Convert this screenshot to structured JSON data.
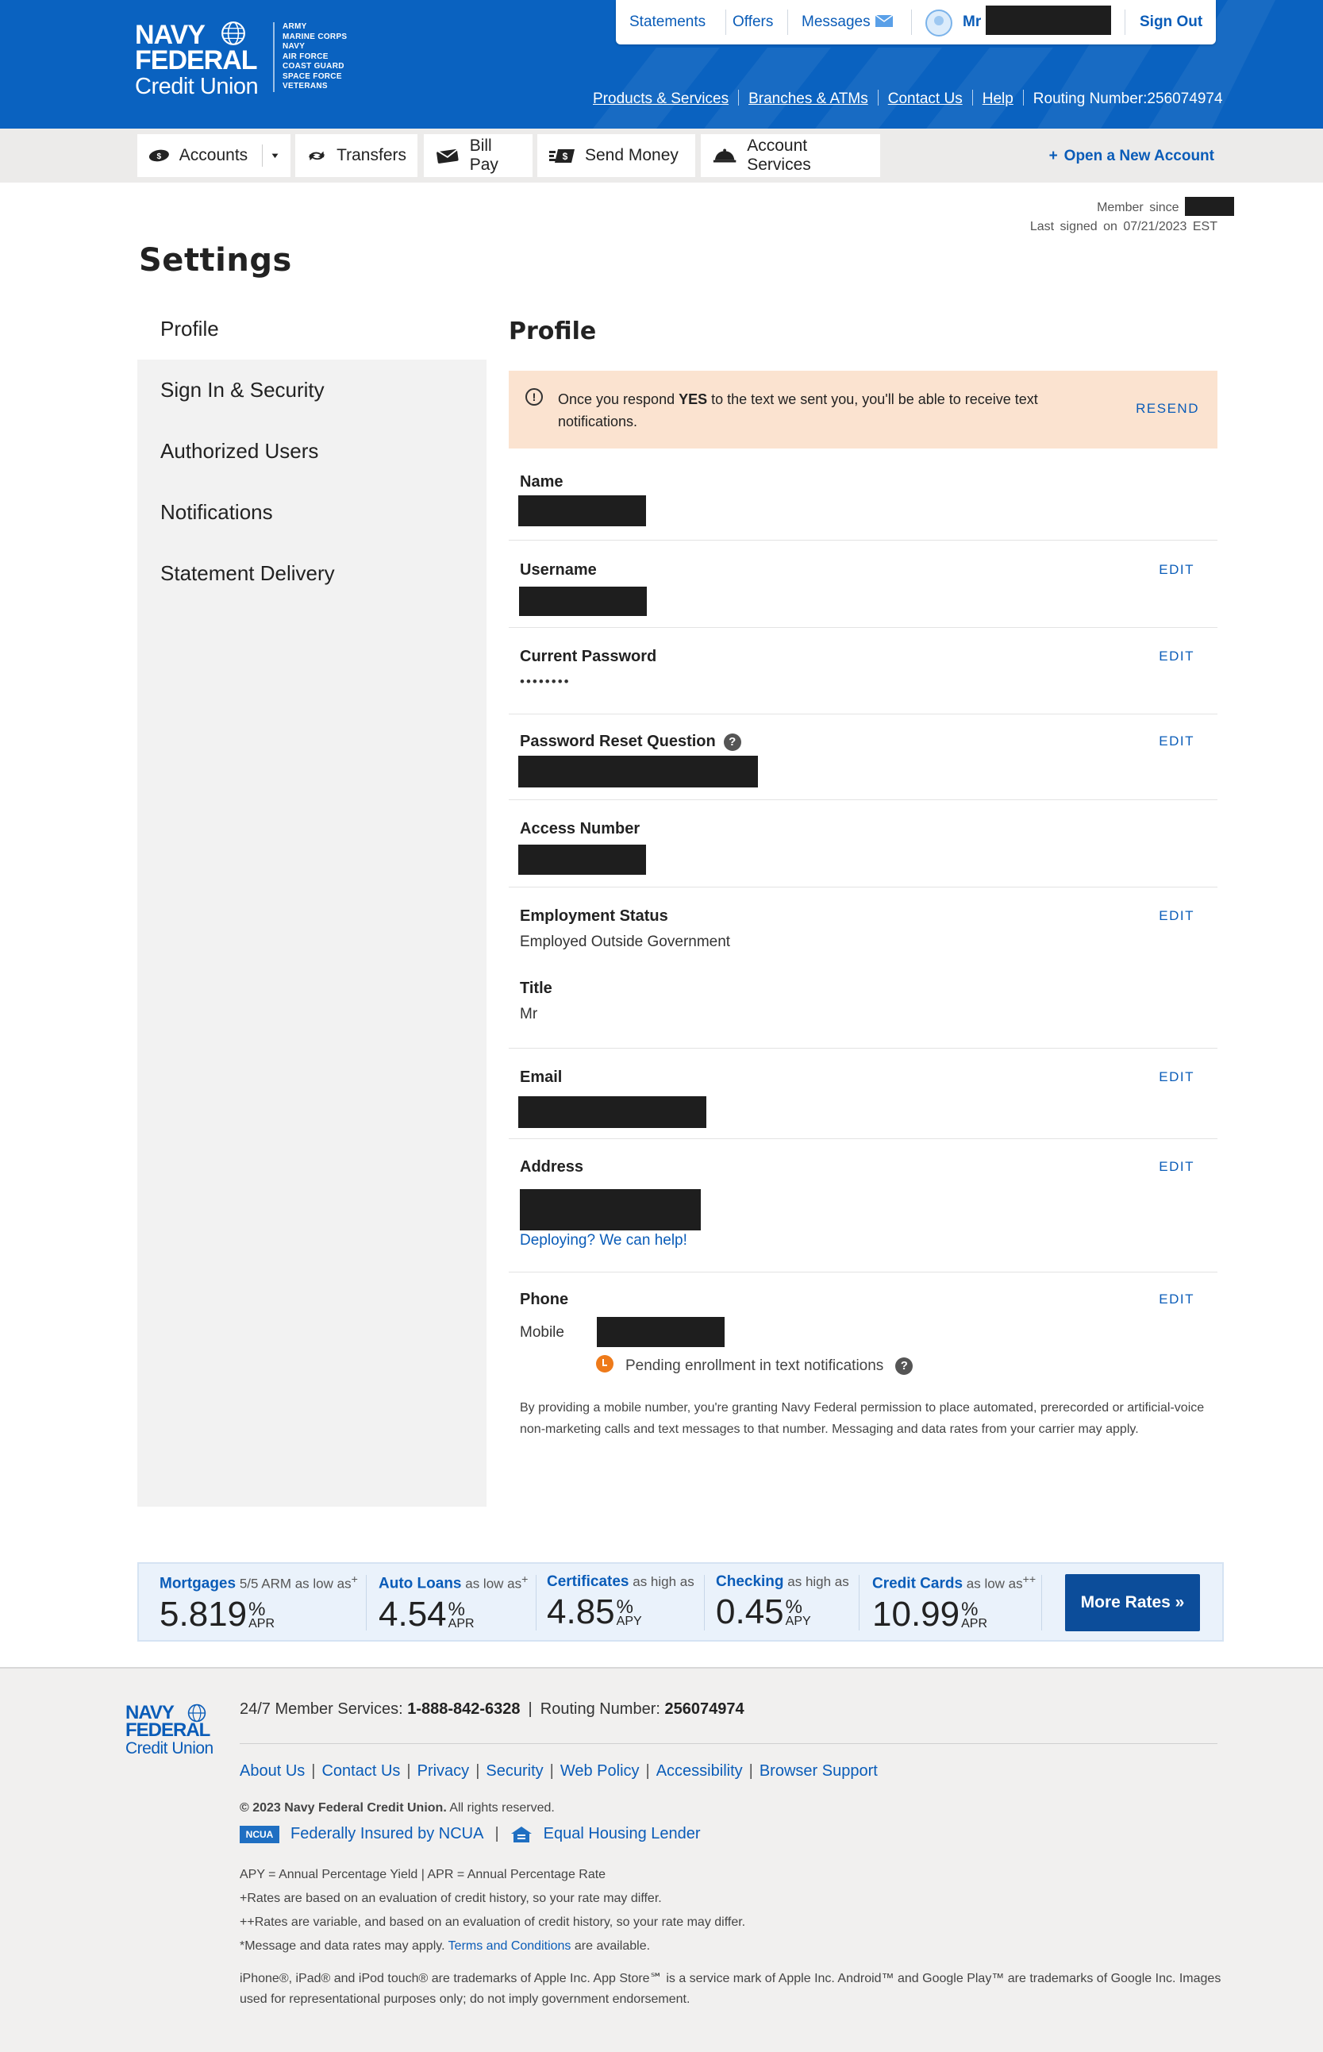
{
  "brand": {
    "line1": "NAVY",
    "line2": "FEDERAL",
    "line3": "Credit Union",
    "branches": [
      "ARMY",
      "MARINE CORPS",
      "NAVY",
      "AIR FORCE",
      "COAST GUARD",
      "SPACE FORCE",
      "VETERANS"
    ]
  },
  "topbar": {
    "statements": "Statements",
    "offers": "Offers",
    "messages": "Messages",
    "user_prefix": "Mr",
    "sign_out": "Sign Out"
  },
  "subnav": {
    "products": "Products & Services",
    "branches": "Branches & ATMs",
    "contact": "Contact Us",
    "help": "Help",
    "routing": "Routing Number:256074974"
  },
  "mainnav": {
    "accounts": "Accounts",
    "transfers": "Transfers",
    "bill_pay": "Bill Pay",
    "send_money": "Send Money",
    "account_services": "Account Services",
    "open_account": "Open a New Account"
  },
  "member": {
    "since_label": "Member since",
    "last_signed": "Last signed on 07/21/2023 EST"
  },
  "page_title": "Settings",
  "sidebar": {
    "items": [
      "Profile",
      "Sign In & Security",
      "Authorized Users",
      "Notifications",
      "Statement Delivery"
    ]
  },
  "profile": {
    "title": "Profile",
    "alert_pre": "Once you respond ",
    "alert_bold": "YES",
    "alert_post": " to the text we sent you, you'll be able to receive text notifications.",
    "resend": "RESEND",
    "edit": "EDIT",
    "name_label": "Name",
    "username_label": "Username",
    "password_label": "Current Password",
    "password_value": "••••••••",
    "reset_q_label": "Password Reset Question",
    "access_label": "Access Number",
    "employment_label": "Employment Status",
    "employment_value": "Employed Outside Government",
    "title_label": "Title",
    "title_value": "Mr",
    "email_label": "Email",
    "address_label": "Address",
    "deploying_link": "Deploying? We can help!",
    "phone_label": "Phone",
    "phone_type": "Mobile",
    "pending": "Pending enrollment in text notifications",
    "disclaimer": "By providing a mobile number, you're granting Navy Federal permission to place automated, prerecorded or artificial-voice non-marketing calls and text messages to that number. Messaging and data rates from your carrier may apply."
  },
  "rates": {
    "items": [
      {
        "name": "Mortgages",
        "qual": "5/5 ARM as low as",
        "mark": "+",
        "value": "5.819",
        "unit": "APR"
      },
      {
        "name": "Auto Loans",
        "qual": "as low as",
        "mark": "+",
        "value": "4.54",
        "unit": "APR"
      },
      {
        "name": "Certificates",
        "qual": "as high as",
        "mark": "",
        "value": "4.85",
        "unit": "APY"
      },
      {
        "name": "Checking",
        "qual": "as high as",
        "mark": "",
        "value": "0.45",
        "unit": "APY"
      },
      {
        "name": "Credit Cards",
        "qual": "as low as",
        "mark": "++",
        "value": "10.99",
        "unit": "APR"
      }
    ],
    "more": "More Rates »"
  },
  "footer": {
    "services_label": "24/7 Member Services: ",
    "services_phone": "1-888-842-6328",
    "routing_label": "Routing Number: ",
    "routing_value": "256074974",
    "links": [
      "About Us",
      "Contact Us",
      "Privacy",
      "Security",
      "Web Policy",
      "Accessibility",
      "Browser Support"
    ],
    "copyright_bold": "© 2023 Navy Federal Credit Union.",
    "copyright_rest": " All rights reserved.",
    "ncua_badge": "NCUA",
    "insured": "Federally Insured by NCUA",
    "housing": "Equal Housing Lender",
    "note1": "APY = Annual Percentage Yield | APR = Annual Percentage Rate",
    "note2": "+Rates are based on an evaluation of credit history, so your rate may differ.",
    "note3": "++Rates are variable, and based on an evaluation of credit history, so your rate may differ.",
    "note4_pre": "*Message and data rates may apply. ",
    "note4_link": "Terms and Conditions",
    "note4_post": " are available.",
    "trademarks": "iPhone®, iPad® and iPod touch® are trademarks of Apple Inc. App Store℠ is a service mark of Apple Inc. Android™ and Google Play™ are trademarks of Google Inc. Images used for representational purposes only; do not imply government endorsement."
  },
  "colors": {
    "brand_blue": "#0a62c0",
    "link_blue": "#0a5cb8",
    "alert_bg": "#fbe3d0",
    "pending_orange": "#ee7a1a"
  }
}
